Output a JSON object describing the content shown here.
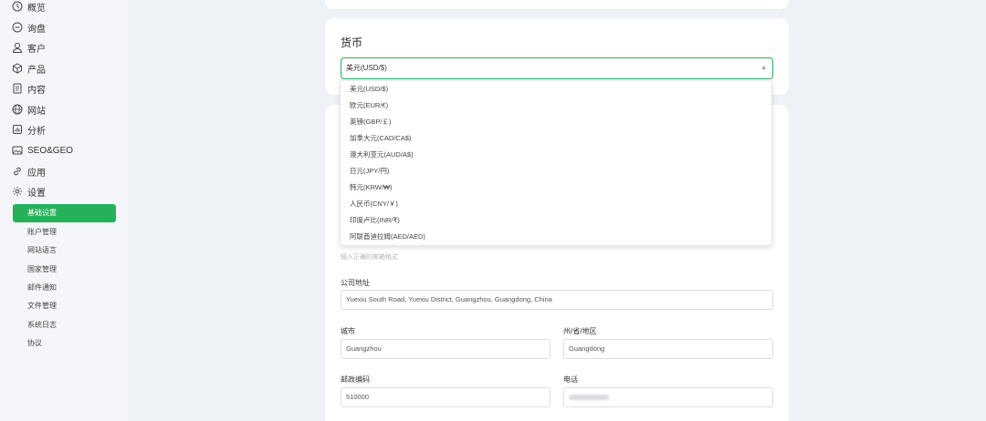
{
  "sidebar": {
    "items": [
      {
        "label": "概览",
        "icon": "clock-icon"
      },
      {
        "label": "询盘",
        "icon": "chat-icon"
      },
      {
        "label": "客户",
        "icon": "user-icon"
      },
      {
        "label": "产品",
        "icon": "box-icon"
      },
      {
        "label": "内容",
        "icon": "document-icon"
      },
      {
        "label": "网站",
        "icon": "globe-icon"
      },
      {
        "label": "分析",
        "icon": "analytics-icon"
      },
      {
        "label": "SEO&GEO",
        "icon": "image-icon"
      },
      {
        "label": "应用",
        "icon": "link-icon"
      },
      {
        "label": "设置",
        "icon": "gear-icon"
      }
    ],
    "sub_items": [
      {
        "label": "基础设置",
        "active": true
      },
      {
        "label": "账户管理",
        "active": false
      },
      {
        "label": "网站语言",
        "active": false
      },
      {
        "label": "国家管理",
        "active": false
      },
      {
        "label": "邮件通知",
        "active": false
      },
      {
        "label": "文件管理",
        "active": false
      },
      {
        "label": "系统日志",
        "active": false
      },
      {
        "label": "协议",
        "active": false
      }
    ]
  },
  "currency": {
    "title": "货币",
    "selected": "美元(USD/$)",
    "options": [
      "美元(USD/$)",
      "欧元(EUR/€)",
      "英镑(GBP/￡)",
      "加拿大元(CAD/CA$)",
      "澳大利亚元(AUD/A$)",
      "日元(JPY/円)",
      "韩元(KRW/₩)",
      "人民币(CNY/￥)",
      "印度卢比(INR/₹)",
      "阿联酋迪拉姆(AED/AED)"
    ]
  },
  "form": {
    "email_hint": "输入正确的邮箱格式",
    "address_label": "公司地址",
    "address_value": "Yuexiu South Road, Yuexiu District, Guangzhou, Guangdong, China",
    "city_label": "城市",
    "city_value": "Guangzhou",
    "state_label": "州/省/地区",
    "state_value": "Guangdong",
    "zip_label": "邮政编码",
    "zip_value": "510000",
    "phone_label": "电话"
  },
  "colors": {
    "accent": "#27b05a",
    "background": "#eef1f5",
    "card": "#ffffff"
  }
}
